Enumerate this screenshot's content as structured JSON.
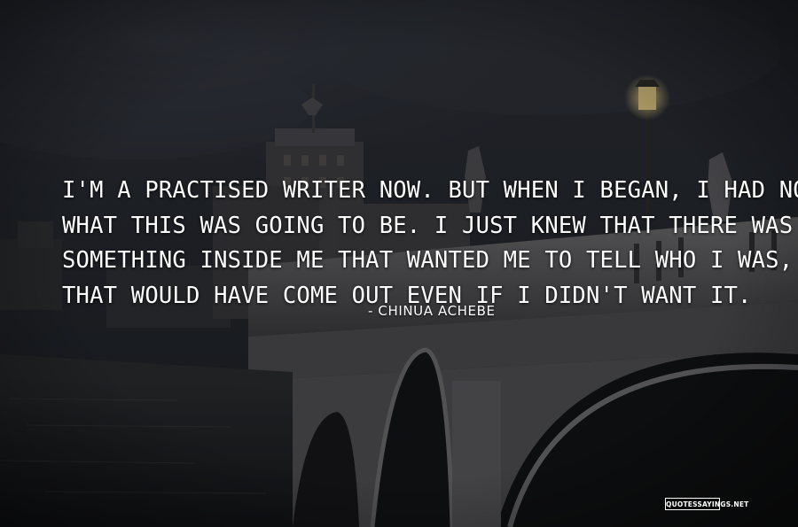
{
  "quote": {
    "lines": [
      "I'M A PRACTISED WRITER NOW. BUT WHEN I BEGAN, I HAD NO IDEA",
      "WHAT THIS WAS GOING TO BE. I JUST KNEW THAT THERE WAS",
      "SOMETHING INSIDE ME THAT WANTED ME TO TELL WHO I WAS, AND",
      "THAT WOULD HAVE COME OUT EVEN IF I DIDN'T WANT IT."
    ],
    "author": "- CHINUA ACHEBE"
  },
  "watermark": "QUOTESSAYINGS.NET",
  "colors": {
    "text": "#ffffff",
    "sky": "#23262e",
    "stone": "#5a5a5c",
    "water": "#1c1f24"
  }
}
